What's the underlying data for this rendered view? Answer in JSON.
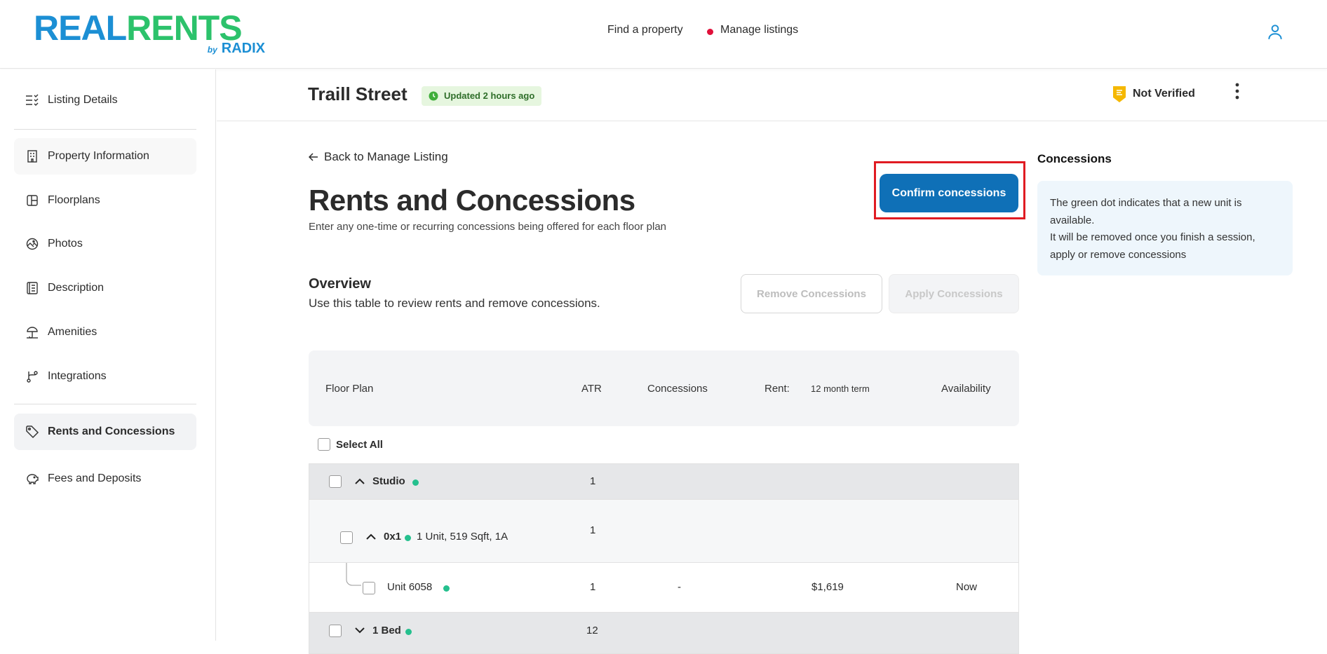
{
  "header": {
    "logo": {
      "real": "REAL",
      "rents": "RENTS",
      "by": "by",
      "brand": "RADIX"
    },
    "nav": [
      {
        "label": "Find a property"
      },
      {
        "label": "Manage listings"
      }
    ],
    "user_icon": "user-icon"
  },
  "sidebar": {
    "items": [
      {
        "label": "Listing Details",
        "icon": "checklist-icon"
      },
      {
        "label": "Property Information",
        "icon": "building-icon"
      },
      {
        "label": "Floorplans",
        "icon": "floorplan-icon"
      },
      {
        "label": "Photos",
        "icon": "photos-icon"
      },
      {
        "label": "Description",
        "icon": "description-icon"
      },
      {
        "label": "Amenities",
        "icon": "umbrella-icon"
      },
      {
        "label": "Integrations",
        "icon": "integrations-icon"
      },
      {
        "label": "Rents and Concessions",
        "icon": "tag-icon"
      },
      {
        "label": "Fees and Deposits",
        "icon": "piggy-bank-icon"
      }
    ]
  },
  "page_header": {
    "title": "Traill Street",
    "updated": "Updated 2 hours ago",
    "verification": "Not Verified"
  },
  "main": {
    "back_link": "Back to Manage Listing",
    "title": "Rents and Concessions",
    "subtitle": "Enter any one-time or recurring concessions being offered for each floor plan",
    "confirm_button": "Confirm concessions",
    "overview_title": "Overview",
    "overview_sub": "Use this table to review rents and remove concessions.",
    "remove_button": "Remove Concessions",
    "apply_button": "Apply Concessions"
  },
  "table": {
    "headers": {
      "floor_plan": "Floor Plan",
      "atr": "ATR",
      "concessions": "Concessions",
      "rent": "Rent:",
      "term": "12 month term",
      "availability": "Availability"
    },
    "select_all": "Select All",
    "rows": [
      {
        "label": "Studio",
        "atr": "1"
      },
      {
        "label": "0x1",
        "detail": "1 Unit, 519 Sqft, 1A",
        "atr": "1"
      },
      {
        "label": "Unit 6058",
        "atr": "1",
        "concessions": "-",
        "rent": "$1,619",
        "availability": "Now"
      },
      {
        "label": "1 Bed",
        "atr": "12"
      }
    ]
  },
  "info_panel": {
    "title": "Concessions",
    "lines": [
      "The green dot indicates that a new unit is",
      "available.",
      "It will be removed once you finish a session,",
      "apply or remove concessions"
    ]
  },
  "colors": {
    "brand_blue": "#1c8fd4",
    "brand_green": "#2cc26b",
    "primary_button": "#0f70b7",
    "highlight_border": "#e01b22",
    "new_unit_dot": "#25c08e"
  }
}
